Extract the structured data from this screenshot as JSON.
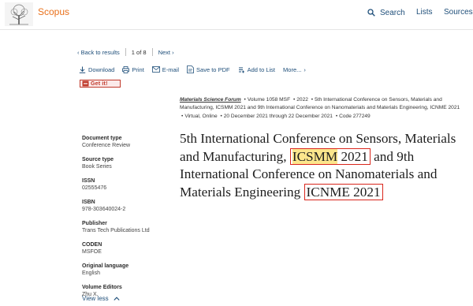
{
  "header": {
    "brand": "Scopus",
    "search_label": "Search",
    "lists_label": "Lists",
    "sources_label": "Sources"
  },
  "nav": {
    "back_label": "Back to results",
    "position": "1",
    "of_label": "of",
    "total": "8",
    "next_label": "Next"
  },
  "actions": {
    "download": "Download",
    "print": "Print",
    "email": "E-mail",
    "save_pdf": "Save to PDF",
    "add_list": "Add to List",
    "more": "More..."
  },
  "getit_label": "Get it!",
  "source": {
    "name": "Materials Science Forum",
    "details": "Volume 1058 MSF",
    "year": "2022",
    "conference": "5th International Conference on Sensors, Materials and Manufacturing, ICSMM 2021 and 9th International Conference on Nanomaterials and Materials Engineering, ICNME 2021",
    "location": "Virtual, Online",
    "dates": "20 December 2021 through 22 December 2021",
    "code": "Code 277249"
  },
  "title": {
    "part1": "5th International Conference on Sensors, Materials and Manufacturing,",
    "abbr1a": "ICSMM",
    "abbr1b": "2021",
    "part2": "and 9th International Conference on Nanomaterials and Materials Engineering",
    "abbr2": "ICNME 2021"
  },
  "metadata": [
    {
      "label": "Document type",
      "value": "Conference Review"
    },
    {
      "label": "Source type",
      "value": "Book Series"
    },
    {
      "label": "ISSN",
      "value": "02555476"
    },
    {
      "label": "ISBN",
      "value": "978-303640024-2"
    },
    {
      "label": "Publisher",
      "value": "Trans Tech Publications Ltd"
    },
    {
      "label": "CODEN",
      "value": "MSFOE"
    },
    {
      "label": "Original language",
      "value": "English"
    },
    {
      "label": "Volume Editors",
      "value": "Zhu X."
    }
  ],
  "view_less": "View less",
  "colors": {
    "brand": "#e9711c",
    "link": "#1f4f7a",
    "highlight_box": "#d9261c",
    "highlight_fill": "#fce68c"
  }
}
